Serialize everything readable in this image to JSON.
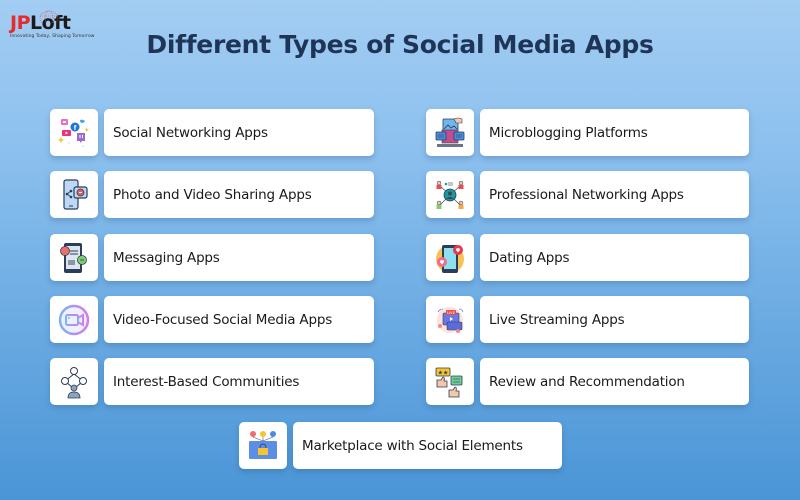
{
  "brand": {
    "name_part1": "JP",
    "name_part2": "Loft",
    "tagline": "Innovating Today, Shaping Tomorrow"
  },
  "title": "Different Types of Social Media Apps",
  "left_column": [
    {
      "label": "Social Networking Apps",
      "icon": "social-networking-icon"
    },
    {
      "label": "Photo and Video Sharing Apps",
      "icon": "photo-video-sharing-icon"
    },
    {
      "label": "Messaging Apps",
      "icon": "messaging-icon"
    },
    {
      "label": "Video-Focused Social Media Apps",
      "icon": "video-camera-icon"
    },
    {
      "label": "Interest-Based Communities",
      "icon": "community-network-icon"
    }
  ],
  "right_column": [
    {
      "label": "Microblogging Platforms",
      "icon": "microblogging-icon"
    },
    {
      "label": "Professional Networking Apps",
      "icon": "professional-network-icon"
    },
    {
      "label": "Dating Apps",
      "icon": "dating-phone-hearts-icon"
    },
    {
      "label": "Live Streaming Apps",
      "icon": "live-streaming-icon"
    },
    {
      "label": "Review and Recommendation",
      "icon": "review-thumbs-up-icon"
    }
  ],
  "bottom": {
    "label": "Marketplace with Social Elements",
    "icon": "marketplace-shop-icon"
  }
}
